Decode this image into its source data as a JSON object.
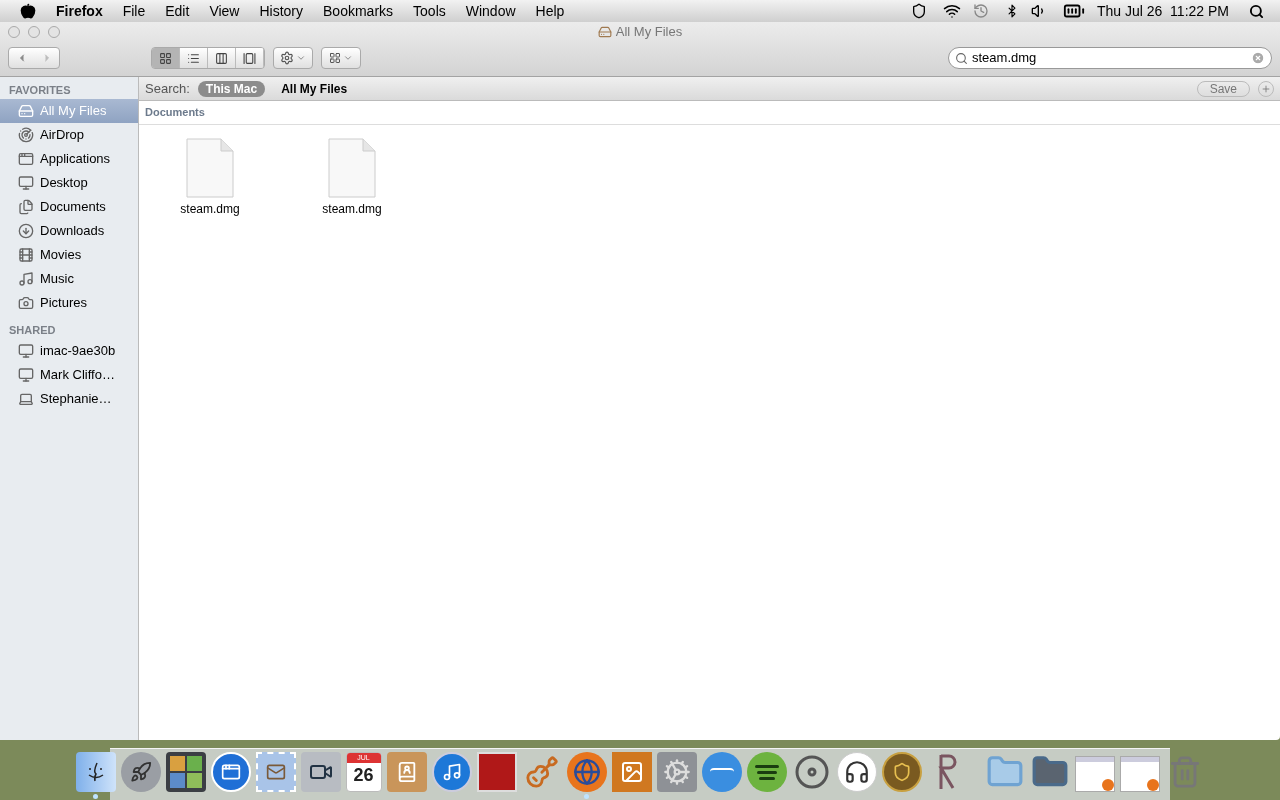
{
  "menubar": {
    "app": "Firefox",
    "menus": [
      "File",
      "Edit",
      "View",
      "History",
      "Bookmarks",
      "Tools",
      "Window",
      "Help"
    ],
    "clock": "Thu Jul 26  11:22 PM"
  },
  "window": {
    "title": "All My Files",
    "view_modes": [
      {
        "kind": "icons",
        "selected": true
      },
      {
        "kind": "list",
        "selected": false
      },
      {
        "kind": "columns",
        "selected": false
      },
      {
        "kind": "coverflow",
        "selected": false
      }
    ],
    "search": {
      "value": "steam.dmg"
    },
    "scope_bar": {
      "label": "Search:",
      "scopes": [
        {
          "label": "This Mac",
          "selected": true
        },
        {
          "label": "All My Files",
          "selected": false
        }
      ],
      "save": "Save"
    }
  },
  "sidebar": [
    {
      "heading": "FAVORITES",
      "items": [
        {
          "label": "All My Files",
          "kind": "allfiles",
          "selected": true
        },
        {
          "label": "AirDrop",
          "kind": "airdrop",
          "selected": false
        },
        {
          "label": "Applications",
          "kind": "apps",
          "selected": false
        },
        {
          "label": "Desktop",
          "kind": "desktop",
          "selected": false
        },
        {
          "label": "Documents",
          "kind": "documents",
          "selected": false
        },
        {
          "label": "Downloads",
          "kind": "downloads",
          "selected": false
        },
        {
          "label": "Movies",
          "kind": "movies",
          "selected": false
        },
        {
          "label": "Music",
          "kind": "music",
          "selected": false
        },
        {
          "label": "Pictures",
          "kind": "pictures",
          "selected": false
        }
      ]
    },
    {
      "heading": "SHARED",
      "items": [
        {
          "label": "imac-9ae30b",
          "kind": "imac",
          "selected": false
        },
        {
          "label": "Mark Cliffo…",
          "kind": "display",
          "selected": false
        },
        {
          "label": "Stephanie…",
          "kind": "laptop",
          "selected": false
        }
      ]
    }
  ],
  "content": {
    "group": "Documents",
    "files": [
      {
        "name": "steam.dmg"
      },
      {
        "name": "steam.dmg"
      }
    ]
  },
  "dock": {
    "items": [
      {
        "kind": "finder",
        "running": true
      },
      {
        "kind": "launchpad",
        "running": false
      },
      {
        "kind": "photos",
        "running": false
      },
      {
        "kind": "appstore",
        "running": false
      },
      {
        "kind": "mail",
        "running": false
      },
      {
        "kind": "facetime",
        "running": false
      },
      {
        "kind": "calendar",
        "running": false,
        "month": "JUL",
        "day": "26"
      },
      {
        "kind": "contacts",
        "running": false
      },
      {
        "kind": "itunes",
        "running": false
      },
      {
        "kind": "photobooth",
        "running": false
      },
      {
        "kind": "guitar",
        "running": false
      },
      {
        "kind": "firefox",
        "running": true
      },
      {
        "kind": "iphoto",
        "running": false
      },
      {
        "kind": "settings",
        "running": false
      },
      {
        "kind": "office",
        "running": false
      },
      {
        "kind": "spotify",
        "running": false
      },
      {
        "kind": "ring",
        "running": false
      },
      {
        "kind": "headset",
        "running": false
      },
      {
        "kind": "wow",
        "running": false
      },
      {
        "kind": "rlogo",
        "running": false
      },
      {
        "kind": "separator"
      },
      {
        "kind": "folder",
        "running": false
      },
      {
        "kind": "stack",
        "running": false
      },
      {
        "kind": "window",
        "running": false
      },
      {
        "kind": "window",
        "running": false
      },
      {
        "kind": "trash",
        "running": false
      }
    ]
  }
}
